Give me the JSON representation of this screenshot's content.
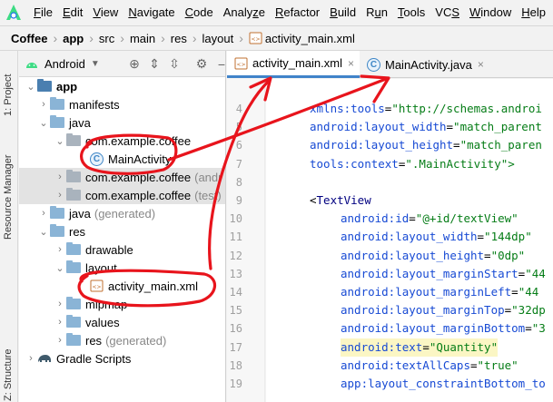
{
  "menu": [
    "File",
    "Edit",
    "View",
    "Navigate",
    "Code",
    "Analyze",
    "Refactor",
    "Build",
    "Run",
    "Tools",
    "VCS",
    "Window",
    "Help"
  ],
  "menu_mnemonic": [
    "F",
    "E",
    "V",
    "N",
    "C",
    "z",
    "R",
    "B",
    "u",
    "T",
    "S",
    "W",
    "H"
  ],
  "breadcrumb": [
    "Coffee",
    "app",
    "src",
    "main",
    "res",
    "layout",
    "activity_main.xml"
  ],
  "left_strip": {
    "project_tab": "1: Project",
    "resource_tab": "Resource Manager",
    "structure_tab": "Z: Structure"
  },
  "panel": {
    "view_selector": "Android"
  },
  "tree": [
    {
      "label": "app",
      "suffix": ""
    },
    {
      "label": "manifests",
      "suffix": ""
    },
    {
      "label": "java",
      "suffix": ""
    },
    {
      "label": "com.example.coffee",
      "suffix": ""
    },
    {
      "label": "MainActivity",
      "suffix": ""
    },
    {
      "label": "com.example.coffee",
      "suffix": "(andr"
    },
    {
      "label": "com.example.coffee",
      "suffix": "(test)"
    },
    {
      "label": "java",
      "suffix": "(generated)"
    },
    {
      "label": "res",
      "suffix": ""
    },
    {
      "label": "drawable",
      "suffix": ""
    },
    {
      "label": "layout",
      "suffix": ""
    },
    {
      "label": "activity_main.xml",
      "suffix": ""
    },
    {
      "label": "mipmap",
      "suffix": ""
    },
    {
      "label": "values",
      "suffix": ""
    },
    {
      "label": "res",
      "suffix": "(generated)"
    },
    {
      "label": "Gradle Scripts",
      "suffix": ""
    }
  ],
  "tabs": [
    {
      "label": "activity_main.xml",
      "close": "×"
    },
    {
      "label": "MainActivity.java",
      "close": "×"
    }
  ],
  "line_numbers": [
    "4",
    "5",
    "6",
    "7",
    "8",
    "9",
    "10",
    "11",
    "12",
    "13",
    "14",
    "15",
    "16",
    "17",
    "18",
    "19"
  ],
  "code": [
    {
      "attr": "xmlns:tools",
      "eq": "=",
      "val": "\"http://schemas.androi"
    },
    {
      "attr": "android:layout_width",
      "eq": "=",
      "val": "\"match_parent"
    },
    {
      "attr": "android:layout_height",
      "eq": "=",
      "val": "\"match_paren"
    },
    {
      "attr": "tools:context",
      "eq": "=",
      "val": "\".MainActivity\">"
    },
    {
      "attr": "",
      "eq": "",
      "val": ""
    },
    {
      "attr": "<TextView",
      "eq": "",
      "val": ""
    },
    {
      "attr": "android:id",
      "eq": "=",
      "val": "\"@+id/textView\""
    },
    {
      "attr": "android:layout_width",
      "eq": "=",
      "val": "\"144dp\""
    },
    {
      "attr": "android:layout_height",
      "eq": "=",
      "val": "\"0dp\""
    },
    {
      "attr": "android:layout_marginStart",
      "eq": "=",
      "val": "\"44"
    },
    {
      "attr": "android:layout_marginLeft",
      "eq": "=",
      "val": "\"44"
    },
    {
      "attr": "android:layout_marginTop",
      "eq": "=",
      "val": "\"32dp"
    },
    {
      "attr": "android:layout_marginBottom",
      "eq": "=",
      "val": "\"3"
    },
    {
      "attr": "android:text",
      "eq": "=",
      "val": "\"Quantity\""
    },
    {
      "attr": "android:textAllCaps",
      "eq": "=",
      "val": "\"true\""
    },
    {
      "attr": "app:layout_constraintBottom_to",
      "eq": "",
      "val": ""
    }
  ],
  "colors": {
    "accent": "#4083c9",
    "annotation": "#e8141c",
    "keyword": "#174ad4",
    "string": "#067d17"
  }
}
